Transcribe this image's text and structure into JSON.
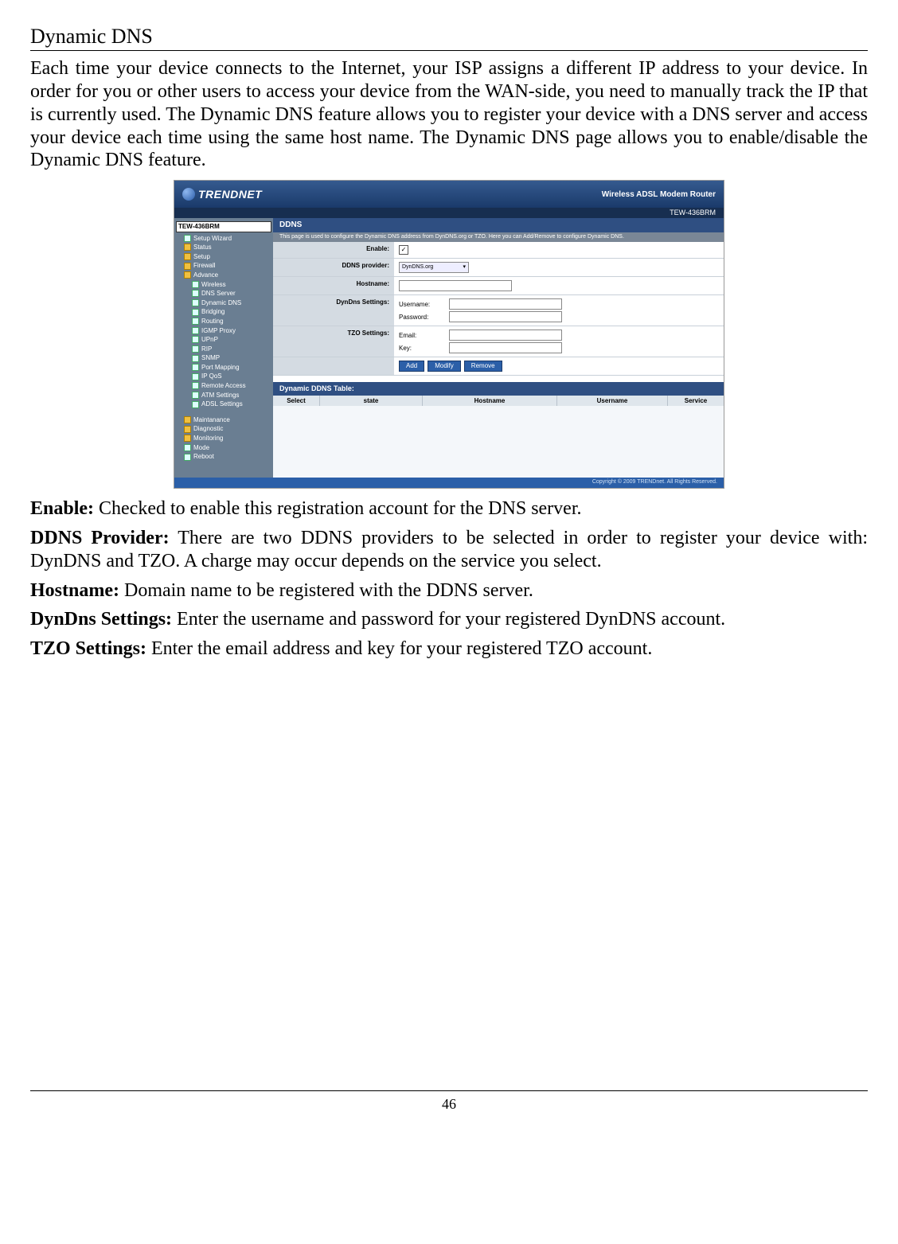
{
  "title": "Dynamic DNS",
  "intro": "Each time your device connects to the Internet, your ISP assigns a different IP address to your device. In order for you or other users to access your device from the WAN-side, you need to manually track the IP that is currently used. The Dynamic DNS feature allows you to register your device with a DNS server and access your device each time using the same host name. The Dynamic DNS page allows you to enable/disable the Dynamic DNS feature.",
  "defs": {
    "enable": {
      "label": "Enable:",
      "text": " Checked to enable this registration account for the DNS server."
    },
    "provider": {
      "label": "DDNS Provider:",
      "text": " There are two DDNS providers to be selected in order to register your device with: DynDNS and TZO. A charge may occur depends on the service you select."
    },
    "hostname": {
      "label": "Hostname:",
      "text": " Domain name to be registered with the DDNS server."
    },
    "dyndns": {
      "label": "DynDns Settings:",
      "text": " Enter the username and password for your registered DynDNS account."
    },
    "tzo": {
      "label": "TZO Settings:",
      "text": " Enter the email address and key for your registered TZO account."
    }
  },
  "router": {
    "brand": "TRENDNET",
    "header_right_1": "Wireless ADSL Modem Router",
    "header_right_2": "TEW-436BRM",
    "root": "TEW-436BRM",
    "nav": {
      "wizard": "Setup Wizard",
      "status": "Status",
      "setup": "Setup",
      "firewall": "Firewall",
      "advance": "Advance",
      "wireless": "Wireless",
      "dnsserver": "DNS Server",
      "dyndns": "Dynamic DNS",
      "bridging": "Bridging",
      "routing": "Routing",
      "igmp": "IGMP Proxy",
      "upnp": "UPnP",
      "rip": "RIP",
      "snmp": "SNMP",
      "portmap": "Port Mapping",
      "ipqos": "IP QoS",
      "remote": "Remote Access",
      "atm": "ATM Settings",
      "adsl": "ADSL Settings",
      "maintenance": "Maintanance",
      "diagnostic": "Diagnostic",
      "monitoring": "Monitoring",
      "mode": "Mode",
      "reboot": "Reboot"
    },
    "panel": {
      "title": "DDNS",
      "desc": "This page is used to configure the Dynamic DNS address from DynDNS.org or TZO. Here you can Add/Remove to configure Dynamic DNS.",
      "form": {
        "enable_label": "Enable:",
        "provider_label": "DDNS provider:",
        "provider_value": "DynDNS.org",
        "hostname_label": "Hostname:",
        "dyndns_label": "DynDns Settings:",
        "username_label": "Username:",
        "password_label": "Password:",
        "tzo_label": "TZO Settings:",
        "email_label": "Email:",
        "key_label": "Key:"
      },
      "buttons": {
        "add": "Add",
        "modify": "Modify",
        "remove": "Remove"
      },
      "table": {
        "title": "Dynamic DDNS Table:",
        "cols": {
          "select": "Select",
          "state": "state",
          "hostname": "Hostname",
          "username": "Username",
          "service": "Service"
        }
      }
    },
    "footer": "Copyright © 2009 TRENDnet. All Rights Reserved."
  },
  "page_number": "46"
}
